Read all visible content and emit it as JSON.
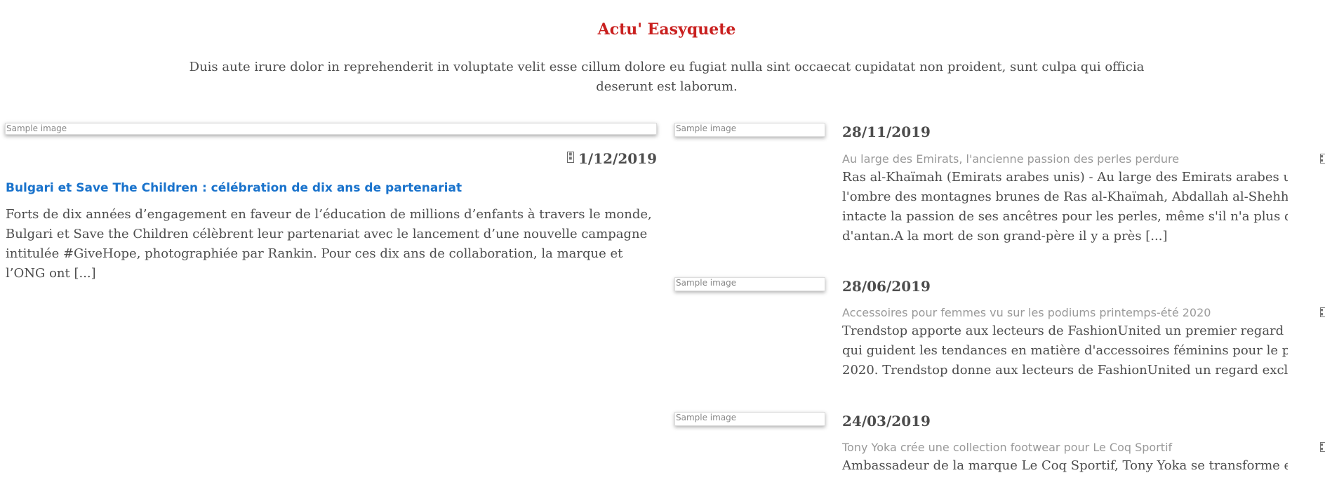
{
  "header": {
    "title": "Actu' Easyquete",
    "intro": "Duis aute irure dolor in reprehenderit in voluptate velit esse cillum dolore eu fugiat nulla sint occaecat cupidatat non proident, sunt culpa qui officia deserunt est laborum."
  },
  "featured": {
    "image_alt": "Sample image",
    "date": "1/12/2019",
    "headline": "Bulgari et Save The Children : célébration de dix ans de partenariat",
    "body": "Forts de dix années d’engagement en faveur de l’éducation de millions d’enfants à travers le monde, Bulgari et Save the Children célèbrent leur partenariat avec le lancement d’une nouvelle campagne intitulée #GiveHope, photographiée par Rankin. Pour ces dix ans de collaboration, la marque et l’ONG ont [...]"
  },
  "articles": [
    {
      "image_alt": "Sample image",
      "date": "28/11/2019",
      "headline": "Au large des Emirats, l'ancienne passion des perles perdure",
      "body": "Ras al-Khaïmah (Emirats arabes unis) - Au large des Emirats arabes unis, et à l'ombre des montagnes brunes de Ras al-Khaïmah, Abdallah al-Shehhi garde intacte la passion de ses ancêtres pour les perles, même s'il n'a plus de pêche d'antan.A la mort de son grand-père il y a près [...]"
    },
    {
      "image_alt": "Sample image",
      "date": "28/06/2019",
      "headline": "Accessoires pour femmes vu sur les podiums printemps-été 2020",
      "body": "Trendstop apporte aux lecteurs de FashionUnited un premier regard sur les pièces qui guident les tendances en matière d'accessoires féminins pour le printemps-été 2020. Trendstop donne aux lecteurs de FashionUnited un regard exclusif sur trois des"
    },
    {
      "image_alt": "Sample image",
      "date": "24/03/2019",
      "headline": "Tony Yoka crée une collection footwear pour Le Coq Sportif",
      "body": "Ambassadeur de la marque Le Coq Sportif, Tony Yoka se transforme en"
    }
  ],
  "icons": {
    "calendar": "calendar-icon",
    "calendar_glyph": "▦"
  },
  "colors": {
    "title": "#c9201f",
    "link": "#1a73cc",
    "text": "#4d4d4d",
    "muted": "#999999"
  }
}
